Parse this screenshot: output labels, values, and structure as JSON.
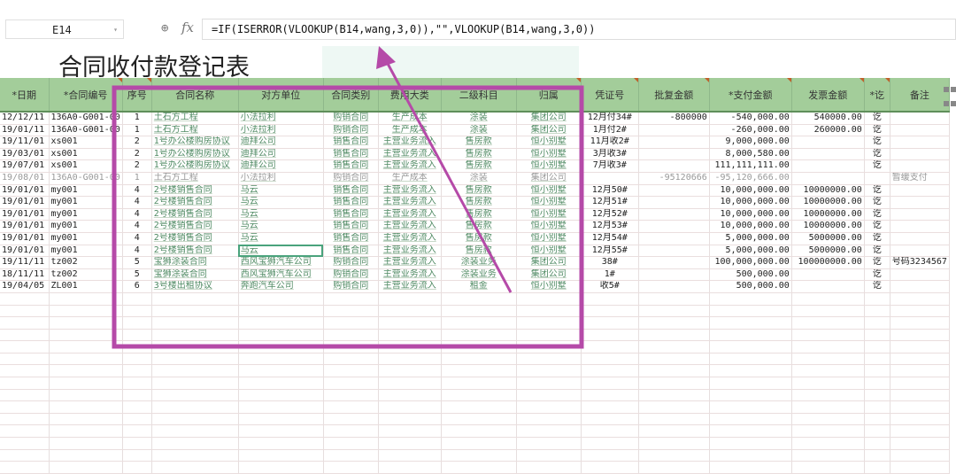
{
  "formula_bar": {
    "cell_ref": "E14",
    "formula": "=IF(ISERROR(VLOOKUP(B14,wang,3,0)),\"\",VLOOKUP(B14,wang,3,0))"
  },
  "sheet_title": "合同收付款登记表",
  "columns": [
    "*日期",
    "*合同编号",
    "序号",
    "合同名称",
    "对方单位",
    "合同类别",
    "费用大类",
    "二级科目",
    "归属",
    "凭证号",
    "批复金额",
    "*支付金额",
    "发票金额",
    "*讫",
    "备注"
  ],
  "rows": [
    [
      "12/12/11",
      "136A0-G001-00",
      "1",
      "土石方工程",
      "小法拉利",
      "购销合同",
      "生产成本",
      "涂装",
      "集团公司",
      "12月付34#",
      "-800000",
      "-540,000.00",
      "540000.00",
      "讫",
      ""
    ],
    [
      "19/01/11",
      "136A0-G001-00",
      "1",
      "土石方工程",
      "小法拉利",
      "购销合同",
      "生产成本",
      "涂装",
      "集团公司",
      "1月付2#",
      "",
      "-260,000.00",
      "260000.00",
      "讫",
      ""
    ],
    [
      "19/11/01",
      "xs001",
      "2",
      "1号办公楼购房协议",
      "迪拜公司",
      "销售合同",
      "主营业务流入",
      "售房款",
      "恒小别墅",
      "11月收2#",
      "",
      "9,000,000.00",
      "",
      "讫",
      ""
    ],
    [
      "19/03/01",
      "xs001",
      "2",
      "1号办公楼购房协议",
      "迪拜公司",
      "销售合同",
      "主营业务流入",
      "售房款",
      "恒小别墅",
      "3月收3#",
      "",
      "8,000,580.00",
      "",
      "讫",
      ""
    ],
    [
      "19/07/01",
      "xs001",
      "2",
      "1号办公楼购房协议",
      "迪拜公司",
      "销售合同",
      "主营业务流入",
      "售房款",
      "恒小别墅",
      "7月收3#",
      "",
      "111,111,111.00",
      "",
      "讫",
      ""
    ],
    [
      "19/08/01",
      "136A0-G001-00",
      "1",
      "土石方工程",
      "小法拉利",
      "购销合同",
      "生产成本",
      "涂装",
      "集团公司",
      "",
      "-95120666",
      "-95,120,666.00",
      "",
      "",
      "暂缓支付"
    ],
    [
      "19/01/01",
      "my001",
      "4",
      "2号楼销售合同",
      "马云",
      "销售合同",
      "主营业务流入",
      "售房款",
      "恒小别墅",
      "12月50#",
      "",
      "10,000,000.00",
      "10000000.00",
      "讫",
      ""
    ],
    [
      "19/01/01",
      "my001",
      "4",
      "2号楼销售合同",
      "马云",
      "销售合同",
      "主营业务流入",
      "售房款",
      "恒小别墅",
      "12月51#",
      "",
      "10,000,000.00",
      "10000000.00",
      "讫",
      ""
    ],
    [
      "19/01/01",
      "my001",
      "4",
      "2号楼销售合同",
      "马云",
      "销售合同",
      "主营业务流入",
      "售房款",
      "恒小别墅",
      "12月52#",
      "",
      "10,000,000.00",
      "10000000.00",
      "讫",
      ""
    ],
    [
      "19/01/01",
      "my001",
      "4",
      "2号楼销售合同",
      "马云",
      "销售合同",
      "主营业务流入",
      "售房款",
      "恒小别墅",
      "12月53#",
      "",
      "10,000,000.00",
      "10000000.00",
      "讫",
      ""
    ],
    [
      "19/01/01",
      "my001",
      "4",
      "2号楼销售合同",
      "马云",
      "销售合同",
      "主营业务流入",
      "售房款",
      "恒小别墅",
      "12月54#",
      "",
      "5,000,000.00",
      "5000000.00",
      "讫",
      ""
    ],
    [
      "19/01/01",
      "my001",
      "4",
      "2号楼销售合同",
      "马云",
      "销售合同",
      "主营业务流入",
      "售房款",
      "恒小别墅",
      "12月55#",
      "",
      "5,000,000.00",
      "5000000.00",
      "讫",
      ""
    ],
    [
      "19/11/11",
      "tz002",
      "5",
      "宝狮涂装合同",
      "西风宝狮汽车公司",
      "购销合同",
      "主营业务流入",
      "涂装业务",
      "集团公司",
      "38#",
      "",
      "100,000,000.00",
      "100000000.00",
      "讫",
      "号码3234567"
    ],
    [
      "18/11/11",
      "tz002",
      "5",
      "宝狮涂装合同",
      "西风宝狮汽车公司",
      "购销合同",
      "主营业务流入",
      "涂装业务",
      "集团公司",
      "1#",
      "",
      "500,000.00",
      "",
      "讫",
      ""
    ],
    [
      "19/04/05",
      "ZL001",
      "6",
      "3号楼出租协议",
      "奔跑汽车公司",
      "购销合同",
      "主营业务流入",
      "租金",
      "恒小别墅",
      "收5#",
      "",
      "500,000.00",
      "",
      "讫",
      ""
    ]
  ],
  "colors": {
    "header": "#a3cd9a",
    "annotation": "#b54aa8",
    "selection": "#4aa37c"
  }
}
